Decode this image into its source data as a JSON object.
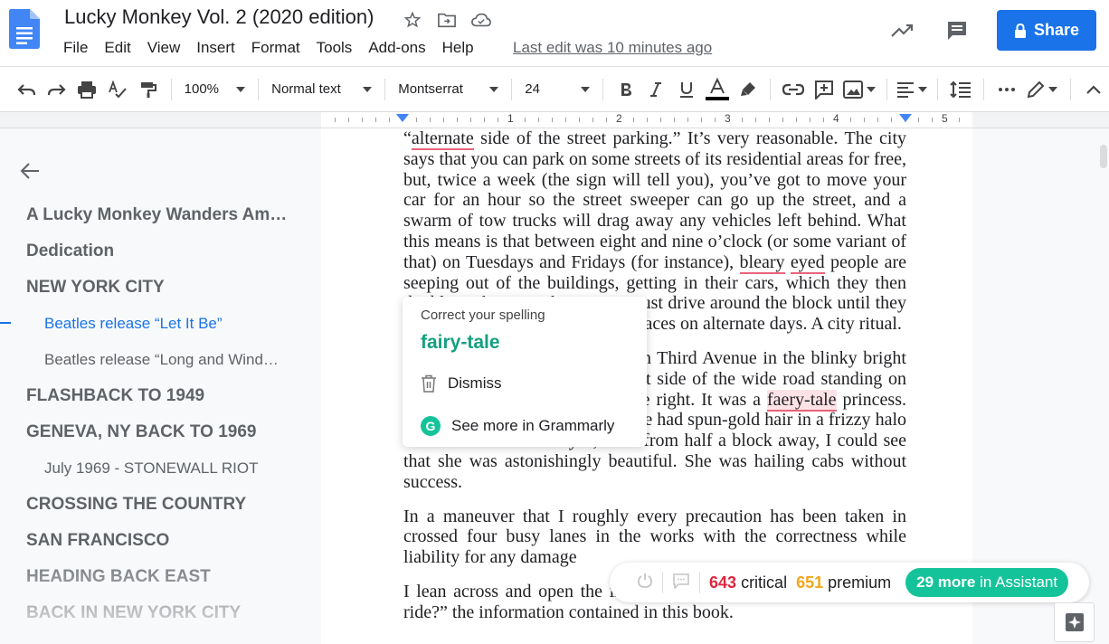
{
  "header": {
    "title": "Lucky Monkey Vol. 2 (2020 edition)",
    "menu": [
      "File",
      "Edit",
      "View",
      "Insert",
      "Format",
      "Tools",
      "Add-ons",
      "Help"
    ],
    "last_edit": "Last edit was 10 minutes ago",
    "share_label": "Share",
    "brand_color": "#1a73e8"
  },
  "toolbar": {
    "zoom": "100%",
    "style": "Normal text",
    "font": "Montserrat",
    "font_size": "24"
  },
  "ruler": {
    "numbers": [
      "1",
      "2",
      "3",
      "4",
      "5"
    ]
  },
  "sidebar": {
    "items": [
      {
        "label": "A Lucky Monkey Wanders Am…",
        "level": 1
      },
      {
        "label": "Dedication",
        "level": 1
      },
      {
        "label": "NEW YORK CITY",
        "level": 1
      },
      {
        "label": "Beatles release “Let It Be”",
        "level": 2,
        "active": true
      },
      {
        "label": "Beatles release “Long and Wind…",
        "level": 2
      },
      {
        "label": "FLASHBACK TO 1949",
        "level": 1
      },
      {
        "label": "GENEVA, NY BACK TO 1969",
        "level": 1
      },
      {
        "label": "July 1969 - STONEWALL RIOT",
        "level": 2
      },
      {
        "label": "CROSSING THE COUNTRY",
        "level": 1
      },
      {
        "label": "SAN FRANCISCO",
        "level": 1
      },
      {
        "label": "HEADING BACK EAST",
        "level": 1
      },
      {
        "label": "BACK IN NEW YORK CITY",
        "level": 1
      }
    ]
  },
  "document": {
    "p1": {
      "a": "“",
      "w1": "alternate",
      "b": " side of the street parking.” It’s very reasonable. The city says that you can park on some streets of its residential areas for free, but, twice a week (the sign will tell you), you’ve got to move your car for an hour so the street sweeper can go up the street, and a swarm of tow trucks will drag away any vehicles left behind. What this means is that between eight and nine o’clock (or some variant of that) on Tuesdays and Fridays (for instance), ",
      "w2": "bleary",
      "w3": "eyed",
      "c": " people are seeping out of the buildings, getting in their cars, which they then double-park across the street or just drive around the block until they can come back and claim their spaces on alternate days. A city ritual."
    },
    "p2": {
      "a": "One morning I was driving down Third Avenue in the blinky bright sun and saw a woman up the left side of the wide road standing on the corner half a block up on the right. It was a ",
      "w1": "faery-tale",
      "b": " princess. Straight out of a picture book. She had spun-gold hair in a frizzy halo around her head. And yes, even from half a block away, I could see that she was astonishingly beautiful. She was hailing cabs without success."
    },
    "p3": "In a maneuver that I roughly every precaution has been taken in crossed four busy lanes in the works with the correctness while liability for any damage",
    "p4": "I lean across and open the image caused or alleged to be caused a ride?” the information contained in this book."
  },
  "grammarly_popup": {
    "heading": "Correct your spelling",
    "suggestion": "fairy-tale",
    "dismiss": "Dismiss",
    "see_more": "See more in Grammarly",
    "logo_letter": "G"
  },
  "grammarly_bar": {
    "critical_count": "643",
    "critical_label": "critical",
    "premium_count": "651",
    "premium_label": "premium",
    "assistant_count": "29 more",
    "assistant_label": "in Assistant"
  }
}
